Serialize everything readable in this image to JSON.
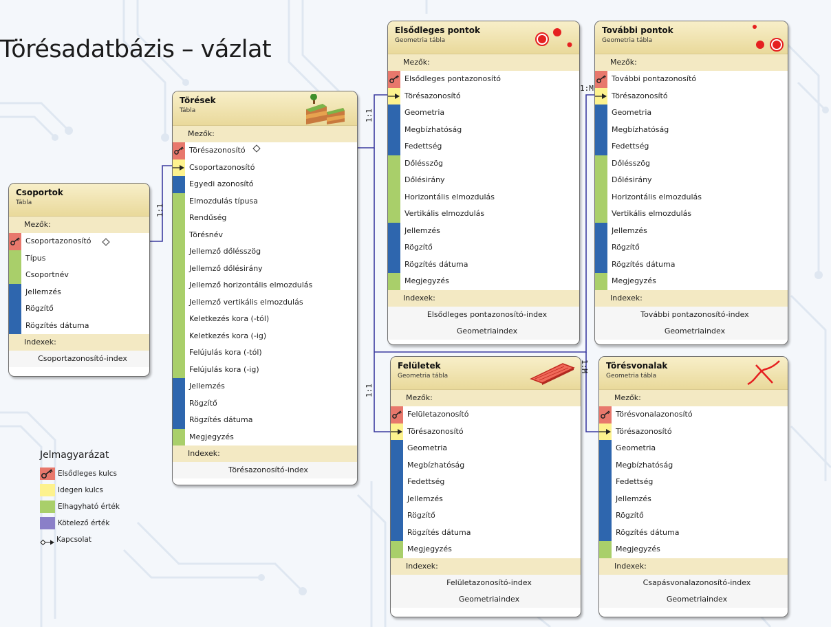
{
  "title": "Törésadatbázis – vázlat",
  "colors": {
    "primary_key": "#e8786c",
    "foreign_key": "#fdf28e",
    "optional": "#a9cf6a",
    "required": "#2e66ae",
    "header": "#efe3b4",
    "connector": "#3b3ba0"
  },
  "labels": {
    "fields": "Mezők:",
    "indexes": "Indexek:"
  },
  "tables": {
    "csoportok": {
      "name": "Csoportok",
      "kind": "Tábla",
      "fields": [
        {
          "label": "Csoportazonosító",
          "type": "pk"
        },
        {
          "label": "Típus",
          "type": "opt"
        },
        {
          "label": "Csoportnév",
          "type": "opt"
        },
        {
          "label": "Jellemzés",
          "type": "req"
        },
        {
          "label": "Rögzítő",
          "type": "req"
        },
        {
          "label": "Rögzítés dátuma",
          "type": "req"
        }
      ],
      "indexes": [
        "Csoportazonosító-index"
      ]
    },
    "toresek": {
      "name": "Törések",
      "kind": "Tábla",
      "icon": "terrain-block-icon",
      "fields": [
        {
          "label": "Törésazonosító",
          "type": "pk"
        },
        {
          "label": "Csoportazonosító",
          "type": "fk"
        },
        {
          "label": "Egyedi azonosító",
          "type": "req"
        },
        {
          "label": "Elmozdulás típusa",
          "type": "opt"
        },
        {
          "label": "Rendűség",
          "type": "opt"
        },
        {
          "label": "Törésnév",
          "type": "opt"
        },
        {
          "label": "Jellemző dőlésszög",
          "type": "opt"
        },
        {
          "label": "Jellemző dőlésirány",
          "type": "opt"
        },
        {
          "label": "Jellemző horizontális elmozdulás",
          "type": "opt"
        },
        {
          "label": "Jellemző vertikális elmozdulás",
          "type": "opt"
        },
        {
          "label": "Keletkezés kora (-tól)",
          "type": "opt"
        },
        {
          "label": "Keletkezés kora (-ig)",
          "type": "opt"
        },
        {
          "label": "Felújulás kora (-tól)",
          "type": "opt"
        },
        {
          "label": "Felújulás kora (-ig)",
          "type": "opt"
        },
        {
          "label": "Jellemzés",
          "type": "req"
        },
        {
          "label": "Rögzítő",
          "type": "req"
        },
        {
          "label": "Rögzítés dátuma",
          "type": "req"
        },
        {
          "label": "Megjegyzés",
          "type": "opt"
        }
      ],
      "indexes": [
        "Törésazonosító-index"
      ]
    },
    "elsodleges": {
      "name": "Elsődleges pontok",
      "kind": "Geometria tábla",
      "icon": "point-symbols-icon",
      "fields": [
        {
          "label": "Elsődleges pontazonosító",
          "type": "pk"
        },
        {
          "label": "Törésazonosító",
          "type": "fk"
        },
        {
          "label": "Geometria",
          "type": "req"
        },
        {
          "label": "Megbízhatóság",
          "type": "req"
        },
        {
          "label": "Fedettség",
          "type": "req"
        },
        {
          "label": "Dőlésszög",
          "type": "opt"
        },
        {
          "label": "Dőlésirány",
          "type": "opt"
        },
        {
          "label": "Horizontális elmozdulás",
          "type": "opt"
        },
        {
          "label": "Vertikális elmozdulás",
          "type": "opt"
        },
        {
          "label": "Jellemzés",
          "type": "req"
        },
        {
          "label": "Rögzítő",
          "type": "req"
        },
        {
          "label": "Rögzítés dátuma",
          "type": "req"
        },
        {
          "label": "Megjegyzés",
          "type": "opt"
        }
      ],
      "indexes": [
        "Elsődleges pontazonosító-index",
        "Geometriaindex"
      ]
    },
    "tovabbi": {
      "name": "További pontok",
      "kind": "Geometria tábla",
      "icon": "point-symbols-icon",
      "fields": [
        {
          "label": "További pontazonosító",
          "type": "pk"
        },
        {
          "label": "Törésazonosító",
          "type": "fk"
        },
        {
          "label": "Geometria",
          "type": "req"
        },
        {
          "label": "Megbízhatóság",
          "type": "req"
        },
        {
          "label": "Fedettség",
          "type": "req"
        },
        {
          "label": "Dőlésszög",
          "type": "opt"
        },
        {
          "label": "Dőlésirány",
          "type": "opt"
        },
        {
          "label": "Horizontális elmozdulás",
          "type": "opt"
        },
        {
          "label": "Vertikális elmozdulás",
          "type": "opt"
        },
        {
          "label": "Jellemzés",
          "type": "req"
        },
        {
          "label": "Rögzítő",
          "type": "req"
        },
        {
          "label": "Rögzítés dátuma",
          "type": "req"
        },
        {
          "label": "Megjegyzés",
          "type": "opt"
        }
      ],
      "indexes": [
        "További pontazonosító-index",
        "Geometriaindex"
      ]
    },
    "feluletek": {
      "name": "Felületek",
      "kind": "Geometria tábla",
      "icon": "surface-plane-icon",
      "fields": [
        {
          "label": "Felületazonosító",
          "type": "pk"
        },
        {
          "label": "Törésazonosító",
          "type": "fk"
        },
        {
          "label": "Geometria",
          "type": "req"
        },
        {
          "label": "Megbízhatóság",
          "type": "req"
        },
        {
          "label": "Fedettség",
          "type": "req"
        },
        {
          "label": "Jellemzés",
          "type": "req"
        },
        {
          "label": "Rögzítő",
          "type": "req"
        },
        {
          "label": "Rögzítés dátuma",
          "type": "req"
        },
        {
          "label": "Megjegyzés",
          "type": "opt"
        }
      ],
      "indexes": [
        "Felületazonosító-index",
        "Geometriaindex"
      ]
    },
    "toresvonalak": {
      "name": "Törésvonalak",
      "kind": "Geometria tábla",
      "icon": "fault-line-icon",
      "fields": [
        {
          "label": "Törésvonalazonosító",
          "type": "pk"
        },
        {
          "label": "Törésazonosító",
          "type": "fk"
        },
        {
          "label": "Geometria",
          "type": "req"
        },
        {
          "label": "Megbízhatóság",
          "type": "req"
        },
        {
          "label": "Fedettség",
          "type": "req"
        },
        {
          "label": "Jellemzés",
          "type": "req"
        },
        {
          "label": "Rögzítő",
          "type": "req"
        },
        {
          "label": "Rögzítés dátuma",
          "type": "req"
        },
        {
          "label": "Megjegyzés",
          "type": "opt"
        }
      ],
      "indexes": [
        "Csapásvonalazonosító-index",
        "Geometriaindex"
      ]
    }
  },
  "cardinalities": {
    "csoportok_toresek": "1:1",
    "toresek_elsodleges": "1:1",
    "toresek_tovabbi": "1:M",
    "toresek_feluletek": "1:1",
    "toresek_toresvonalak": "1:M"
  },
  "legend": {
    "title": "Jelmagyarázat",
    "items": [
      {
        "label": "Elsődleges kulcs",
        "type": "pk"
      },
      {
        "label": "Idegen kulcs",
        "type": "fk_legend"
      },
      {
        "label": "Elhagyható érték",
        "type": "opt_legend"
      },
      {
        "label": "Kötelező érték",
        "type": "req_legend"
      }
    ],
    "relation": "Kapcsolat"
  }
}
